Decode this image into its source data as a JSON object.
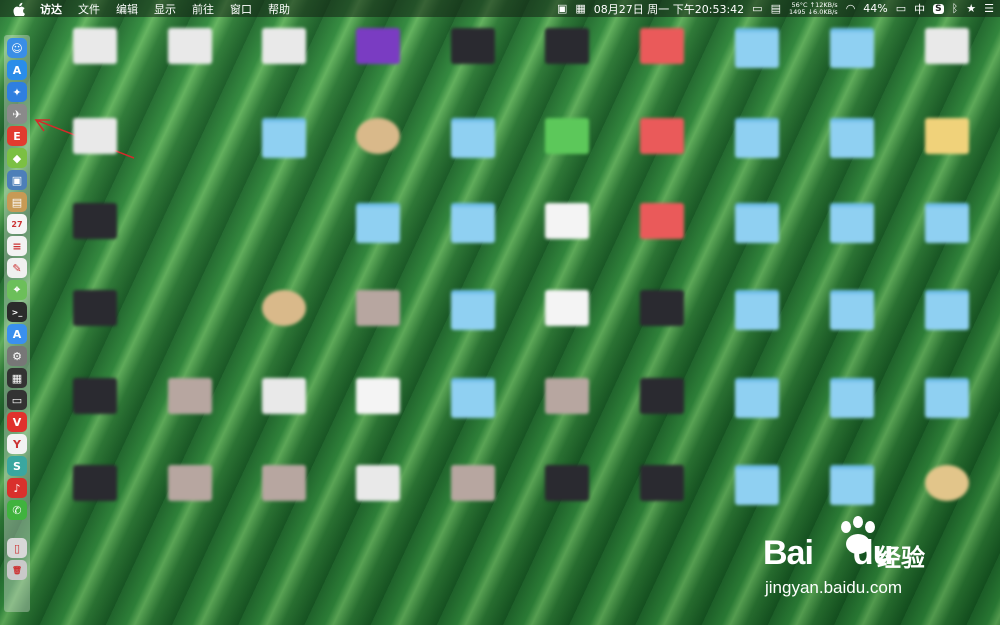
{
  "menubar": {
    "menus": [
      "访达",
      "文件",
      "编辑",
      "显示",
      "前往",
      "窗口",
      "帮助"
    ],
    "clock": "08月27日 周一 下午20:53:42",
    "temp": "56°C",
    "fan": "1495",
    "net_up": "↑12KB/s",
    "net_down": "↓6.0KB/s",
    "battery": "44%",
    "input_method": "中",
    "extra_badge": "S"
  },
  "dock": {
    "apps": [
      {
        "name": "finder-icon",
        "glyph": "☺",
        "color": "#3a8ee6"
      },
      {
        "name": "appstore-icon",
        "glyph": "A",
        "color": "#2a8de9"
      },
      {
        "name": "safari-icon",
        "glyph": "✦",
        "color": "#2f7fe0"
      },
      {
        "name": "launchpad-icon",
        "glyph": "✈",
        "color": "#8a8a8a"
      },
      {
        "name": "app-red-icon",
        "glyph": "E",
        "color": "#e23b2f"
      },
      {
        "name": "android-icon",
        "glyph": "◆",
        "color": "#7bc043"
      },
      {
        "name": "preview-icon",
        "glyph": "▣",
        "color": "#4d7fb8"
      },
      {
        "name": "notes-icon",
        "glyph": "▤",
        "color": "#c79a55"
      },
      {
        "name": "calendar-icon",
        "glyph": "27",
        "color": "#f5f5f5"
      },
      {
        "name": "reminders-icon",
        "glyph": "≡",
        "color": "#f2f2f2"
      },
      {
        "name": "textedit-icon",
        "glyph": "✎",
        "color": "#f0f0f0"
      },
      {
        "name": "maps-icon",
        "glyph": "⌖",
        "color": "#6cbf5a"
      },
      {
        "name": "terminal-icon",
        "glyph": ">_",
        "color": "#2b2b2b"
      },
      {
        "name": "appstore2-icon",
        "glyph": "A",
        "color": "#3a90ee"
      },
      {
        "name": "system-preferences-icon",
        "glyph": "⚙",
        "color": "#777"
      },
      {
        "name": "activity-monitor-icon",
        "glyph": "▦",
        "color": "#333"
      },
      {
        "name": "console-icon",
        "glyph": "▭",
        "color": "#333"
      },
      {
        "name": "vivaldi-icon",
        "glyph": "V",
        "color": "#e0312d"
      },
      {
        "name": "yandex-icon",
        "glyph": "Y",
        "color": "#f2f2f2"
      },
      {
        "name": "app-teal-icon",
        "glyph": "S",
        "color": "#3aa7a0"
      },
      {
        "name": "netease-music-icon",
        "glyph": "♪",
        "color": "#d9302c"
      },
      {
        "name": "wechat-icon",
        "glyph": "✆",
        "color": "#40b33e"
      },
      {
        "name": "document-icon",
        "glyph": "▯",
        "color": "#d8d8d8"
      },
      {
        "name": "trash-icon",
        "glyph": "🗑",
        "color": "#c9c9c9"
      }
    ]
  },
  "watermark": {
    "brand": "Bai",
    "brand2": "du",
    "cn": "经验",
    "url": "jingyan.baidu.com"
  }
}
